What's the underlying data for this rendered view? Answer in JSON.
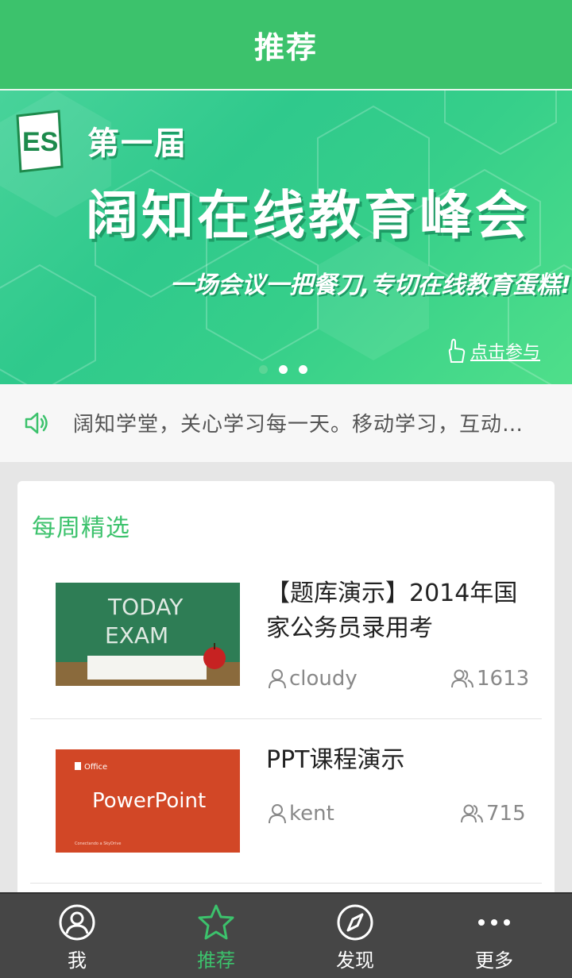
{
  "header": {
    "title": "推荐"
  },
  "banner": {
    "logo_text": "ES",
    "line1": "第一届",
    "line2": "阔知在线教育峰会",
    "line3": "一场会议一把餐刀,专切在线教育蛋糕!",
    "cta": "点击参与",
    "dots": 3,
    "active_dot": 0
  },
  "notice": {
    "icon": "speaker-icon",
    "text": "阔知学堂，关心学习每一天。移动学习，互动…"
  },
  "weekly": {
    "title": "每周精选",
    "courses": [
      {
        "title": "【题库演示】2014年国家公务员录用考",
        "author": "cloudy",
        "count": "1613",
        "thumb_lines": [
          "TODAY",
          "EXAM"
        ]
      },
      {
        "title": "PPT课程演示",
        "author": "kent",
        "count": "715",
        "thumb_brand": "Office",
        "thumb_product": "PowerPoint",
        "thumb_caption": "Conectando a SkyDrive"
      }
    ]
  },
  "tabs": [
    {
      "label": "我",
      "icon": "user-circle-icon",
      "active": false
    },
    {
      "label": "推荐",
      "icon": "star-icon",
      "active": true
    },
    {
      "label": "发现",
      "icon": "compass-icon",
      "active": false
    },
    {
      "label": "更多",
      "icon": "more-dots-icon",
      "active": false
    }
  ],
  "colors": {
    "accent": "#3cc26c",
    "tabbar": "#464646",
    "ppt": "#d24726"
  }
}
